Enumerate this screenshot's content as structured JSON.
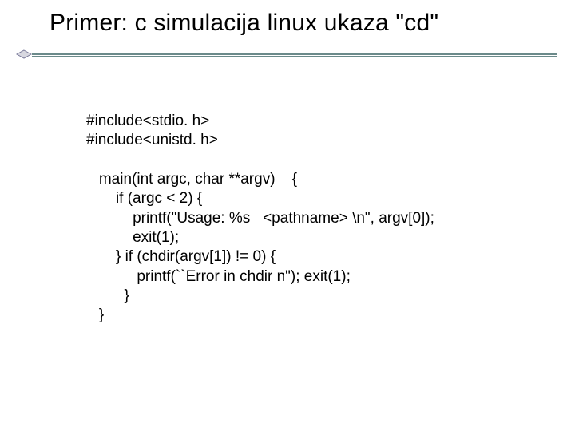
{
  "title": "Primer: c simulacija linux ukaza \"cd\"",
  "code": "#include<stdio. h>\n#include<unistd. h>\n\n   main(int argc, char **argv)    {\n       if (argc < 2) {\n           printf(\"Usage: %s   <pathname> \\n\", argv[0]);\n           exit(1);\n       } if (chdir(argv[1]) != 0) {\n            printf(``Error in chdir n\"); exit(1);\n         }\n   }"
}
